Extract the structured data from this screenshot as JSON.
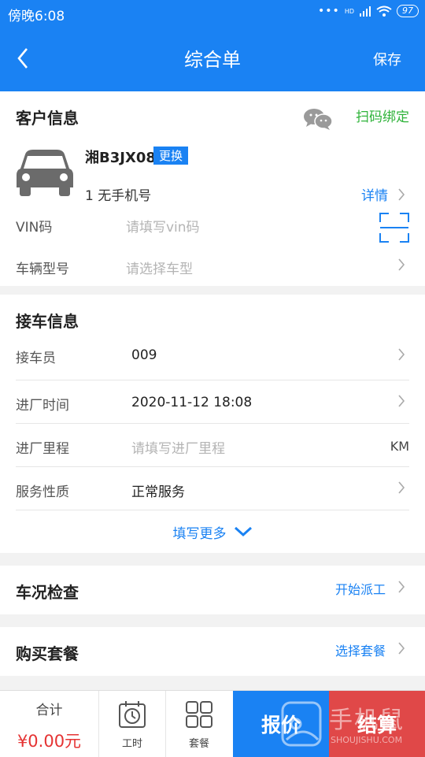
{
  "status_bar": {
    "time": "傍晚6:08",
    "network": "HD",
    "battery": "97"
  },
  "header": {
    "title": "综合单",
    "save_label": "保存"
  },
  "customer": {
    "section_title": "客户信息",
    "scan_bind_label": "扫码绑定",
    "plate": "湘B3JX08",
    "change_label": "更换",
    "contact": "1  无手机号",
    "detail_label": "详情",
    "vin_label": "VIN码",
    "vin_placeholder": "请填写vin码",
    "model_label": "车辆型号",
    "model_placeholder": "请选择车型"
  },
  "reception": {
    "section_title": "接车信息",
    "rows": [
      {
        "label": "接车员",
        "value": "009"
      },
      {
        "label": "进厂时间",
        "value": "2020-11-12 18:08"
      },
      {
        "label": "进厂里程",
        "placeholder": "请填写进厂里程",
        "unit": "KM"
      },
      {
        "label": "服务性质",
        "value": "正常服务"
      }
    ],
    "more_label": "填写更多"
  },
  "inspection": {
    "title": "车况检查",
    "action_label": "开始派工"
  },
  "package": {
    "title": "购买套餐",
    "action_label": "选择套餐"
  },
  "bottom_bar": {
    "total_label": "合计",
    "total_value": "¥0.00元",
    "labor_label": "工时",
    "package_label": "套餐",
    "quote_label": "报价",
    "settle_label": "结算",
    "watermark_text": "手机鼠",
    "watermark_sub": "SHOUJISHU.COM"
  },
  "colors": {
    "primary": "#1a82f3",
    "settle": "#e04848",
    "price": "#e53333",
    "bind": "#2fb33a"
  }
}
